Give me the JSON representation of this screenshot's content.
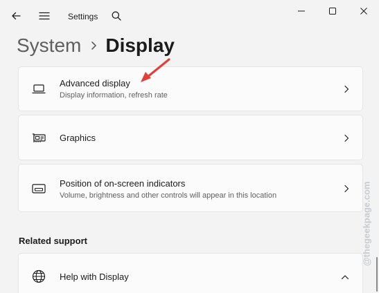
{
  "titlebar": {
    "app_title": "Settings",
    "back_icon": "back-arrow-icon",
    "menu_icon": "hamburger-menu-icon",
    "search_icon": "search-icon",
    "minimize_icon": "minimize-icon",
    "maximize_icon": "maximize-icon",
    "close_icon": "close-icon"
  },
  "breadcrumb": {
    "parent": "System",
    "current": "Display"
  },
  "cards": [
    {
      "title": "Advanced display",
      "subtitle": "Display information, refresh rate",
      "icon": "laptop-display-icon"
    },
    {
      "title": "Graphics",
      "subtitle": "",
      "icon": "graphics-card-icon"
    },
    {
      "title": "Position of on-screen indicators",
      "subtitle": "Volume, brightness and other controls will appear in this location",
      "icon": "screen-indicator-icon"
    }
  ],
  "related_support": {
    "heading": "Related support",
    "items": [
      {
        "title": "Help with Display",
        "icon": "globe-icon",
        "expanded": true
      }
    ]
  },
  "watermark": "@thegeekpage.com",
  "colors": {
    "background": "#f3f3f3",
    "card": "#fbfbfb",
    "annotation_arrow": "#e0403a"
  }
}
